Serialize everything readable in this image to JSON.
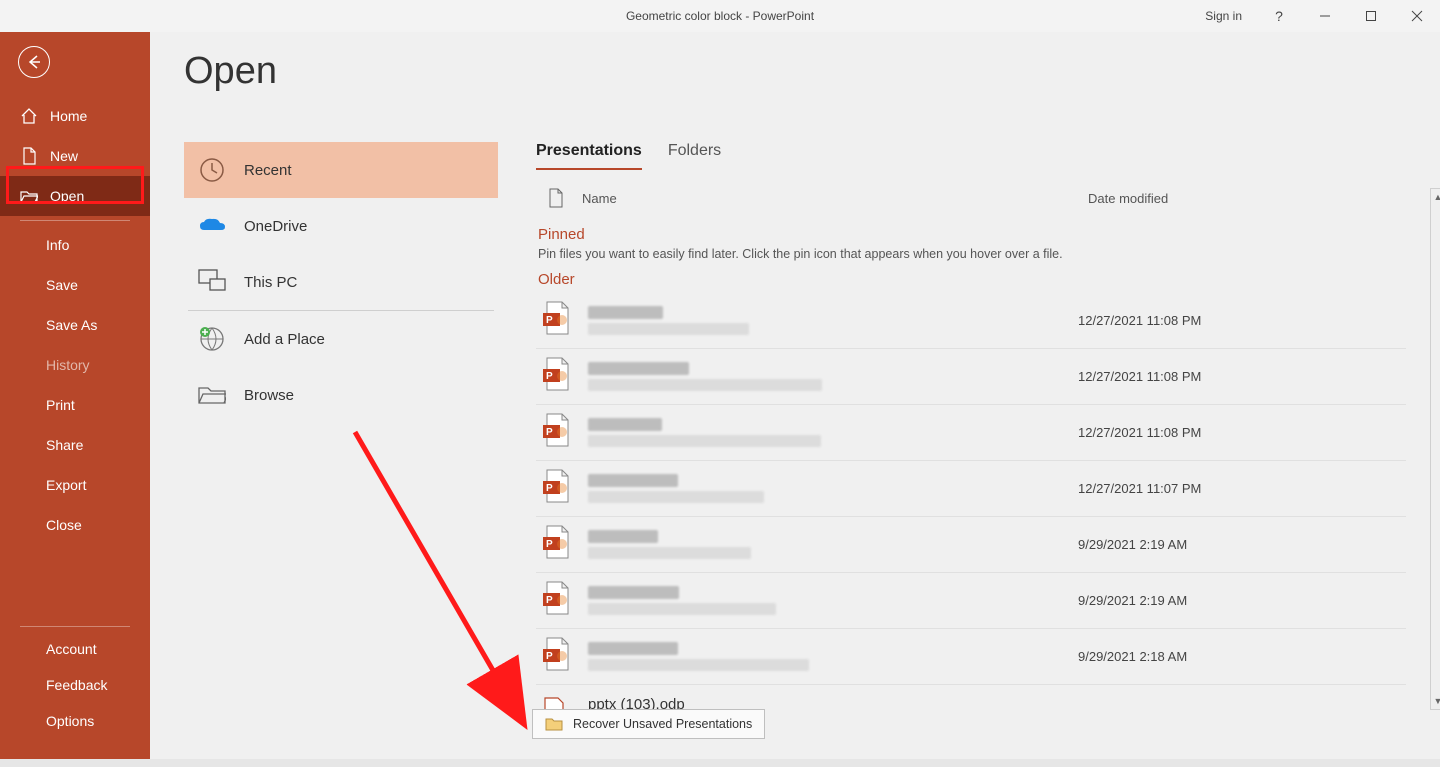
{
  "titlebar": {
    "title": "Geometric color block  -  PowerPoint",
    "sign_in": "Sign in"
  },
  "sidebar": {
    "home": "Home",
    "new": "New",
    "open": "Open",
    "info": "Info",
    "save": "Save",
    "save_as": "Save As",
    "history": "History",
    "print": "Print",
    "share": "Share",
    "export": "Export",
    "close": "Close",
    "account": "Account",
    "feedback": "Feedback",
    "options": "Options"
  },
  "page": {
    "title": "Open"
  },
  "locations": {
    "recent": "Recent",
    "onedrive": "OneDrive",
    "this_pc": "This PC",
    "add_place": "Add a Place",
    "browse": "Browse"
  },
  "tabs": {
    "presentations": "Presentations",
    "folders": "Folders"
  },
  "columns": {
    "name": "Name",
    "date": "Date modified"
  },
  "sections": {
    "pinned_label": "Pinned",
    "pinned_hint": "Pin files you want to easily find later. Click the pin icon that appears when you hover over a file.",
    "older_label": "Older"
  },
  "files": [
    {
      "name": "",
      "path": "",
      "date": "12/27/2021 11:08 PM"
    },
    {
      "name": "",
      "path": "",
      "date": "12/27/2021 11:08 PM"
    },
    {
      "name": "",
      "path": "",
      "date": "12/27/2021 11:08 PM"
    },
    {
      "name": "",
      "path": "",
      "date": "12/27/2021 11:07 PM"
    },
    {
      "name": "",
      "path": "",
      "date": "9/29/2021 2:19 AM"
    },
    {
      "name": "",
      "path": "",
      "date": "9/29/2021 2:19 AM"
    },
    {
      "name": "",
      "path": "",
      "date": "9/29/2021 2:18 AM"
    }
  ],
  "odp_file": {
    "name": "pptx (103).odp"
  },
  "recover_button": "Recover Unsaved Presentations"
}
